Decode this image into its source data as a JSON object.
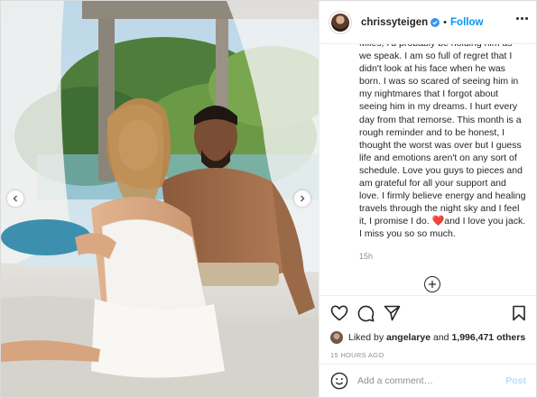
{
  "header": {
    "username": "chrissyteigen",
    "separator": "•",
    "follow_label": "Follow"
  },
  "caption": {
    "text_before_heart": "Miles, I'd probably be holding him as we speak. I am so full of regret that I didn't look at his face when he was born. I was so scared of seeing him in my nightmares that I forgot about seeing him in my dreams. I hurt every day from that remorse. This month is a rough reminder and to be honest, I thought the worst was over but I guess life and emotions aren't on any sort of schedule. Love you guys to pieces and am grateful for all your support and love. I firmly believe energy and healing travels through the night sky and I feel it, I promise I do.",
    "heart": "❤️",
    "text_after_heart": "and I love you jack. I miss you so so much.",
    "time": "15h"
  },
  "likes": {
    "prefix": "Liked by",
    "first_user": "angelarye",
    "conjunction": "and",
    "count": "1,996,471 others"
  },
  "timestamp": "15 HOURS AGO",
  "comment_box": {
    "placeholder": "Add a comment…",
    "post_label": "Post"
  },
  "icons": [
    "chevron-left-icon",
    "chevron-right-icon",
    "heart-icon",
    "comment-icon",
    "share-icon",
    "bookmark-icon",
    "smiley-icon",
    "plus-circle-icon",
    "more-icon",
    "verified-icon"
  ],
  "colors": {
    "accent": "#0095f6",
    "post_disabled": "#b2dffc",
    "muted": "#8e8e8e"
  }
}
